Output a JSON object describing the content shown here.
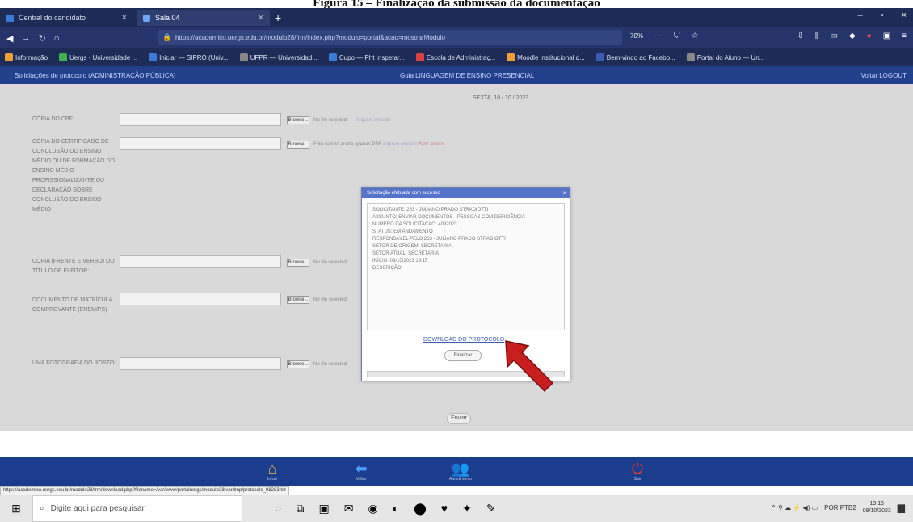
{
  "caption": "Figura 15 – Finalização da submissão da documentação",
  "browser": {
    "tabs": [
      {
        "label": "Central do candidato",
        "close": "×"
      },
      {
        "label": "Sala 04",
        "close": "×"
      }
    ],
    "new_tab": "+",
    "window_controls": [
      "–",
      "▫",
      "×"
    ],
    "url": "https://academico.uergs.edu.br/modulo28/frm/index.php?modulo=portal&acao=mostrarModulo",
    "zoom": "70%",
    "bookmarks": [
      {
        "label": "Informação",
        "color": "#f0a030"
      },
      {
        "label": "Uergs - Universidade ...",
        "color": "#3bb24a"
      },
      {
        "label": "Iniciar — SIPRO (Univ...",
        "color": "#3b7bd8"
      },
      {
        "label": "UFPR — Universidad...",
        "color": "#888888"
      },
      {
        "label": "Cupo — Pht Inspetar...",
        "color": "#3b7bd8"
      },
      {
        "label": "Escola de Administraç...",
        "color": "#e04040"
      },
      {
        "label": "Moodle institucional d...",
        "color": "#f0a030"
      },
      {
        "label": "Bem-vindo ao Facebo...",
        "color": "#3b5bb0"
      },
      {
        "label": "Portal do Aluno — Un...",
        "color": "#888888"
      }
    ]
  },
  "app": {
    "header_left": "Solicitações de protocolo (ADMINISTRAÇÃO PÚBLICA)",
    "header_center": "Guia LINGUAGEM DE ENSINO PRESENCIAL",
    "header_right": "Voltar LOGOUT",
    "date": "SEXTA, 10 / 10 / 2023",
    "rows": [
      {
        "label": "CÓPIA DO CPF:",
        "browse": "Browse...",
        "info": "No file selected.",
        "link": "Arquivo enviado",
        "red": ""
      },
      {
        "label": "CÓPIA DO CERTIFICADO DE CONCLUSÃO DO ENSINO MÉDIO OU DE FORMAÇÃO DO ENSINO MÉDIO PROFISSIONALIZANTE OU DECLARAÇÃO SOBRE CONCLUSÃO DO ENSINO MÉDIO",
        "browse": "Browse...",
        "info": "Este campo aceita apenas PDF",
        "link": "Arquivo enviado",
        "red": "Sem anexo"
      },
      {
        "label": "CÓPIA (FRENTE E VERSO) DO TÍTULO DE ELEITOR:",
        "browse": "Browse...",
        "info": "No file selected.",
        "link": "",
        "red": ""
      },
      {
        "label": "DOCUMENTO DE MATRÍCULA COMPROVANTE (ENEM/PS)",
        "browse": "Browse...",
        "info": "No file selected.",
        "link": "",
        "red": ""
      },
      {
        "label": "UMA FOTOGRAFIA DO ROSTO:",
        "browse": "Browse...",
        "info": "No file selected.",
        "link": "",
        "red": ""
      }
    ],
    "send_label": "Enviar",
    "footer_buttons": [
      {
        "icon": "⌂",
        "label": "Início",
        "color": "#e8c040"
      },
      {
        "icon": "⬅",
        "label": "Voltar",
        "color": "#4aa0ff"
      },
      {
        "icon": "👥",
        "label": "Atendimento",
        "color": "#e8c040"
      },
      {
        "icon": "⏻",
        "label": "Sair",
        "color": "#e33b2b"
      }
    ]
  },
  "modal": {
    "title": "Solicitação efetuada com sucesso",
    "close": "×",
    "text": "SOLICITANTE: 263 - JULIANO PRADO STRADIOTTI\nASSUNTO: ENVIAR DOCUMENTOS - PESSOAS COM DEFICIÊNCIA\nNÚMERO DA SOLICITAÇÃO: 4092023\nSTATUS: EM ANDAMENTO\nRESPONSÁVEL PELO 263 - JULIANO PRADO STRADIOTTI\nSETOR DE ORIGEM: SECRETARIA\nSETOR ATUAL: SECRETARIA\nINÍCIO: 09/10/2023 19:15\nDESCRIÇÃO:",
    "download_link": "DOWNLOAD DO PROTOCOLO",
    "finish_label": "Finalizar"
  },
  "status_url": "https://academico.uergs.edu.br/modulo28/frm/download.php?filename=/var/www/portaluergs/modulo28/var/tmp/protocolo_98283.txt",
  "taskbar": {
    "start": "⊞",
    "search_icon": "⌕",
    "search_placeholder": "Digite aqui para pesquisar",
    "apps": [
      "○",
      "⧉",
      "▣",
      "✉",
      "◉",
      "◐",
      "⬤",
      "♥",
      "✦",
      "✎"
    ],
    "tray_lang": "POR PTB2",
    "time": "19:15",
    "date": "09/10/2023"
  },
  "colors": {
    "tab_bg": "#1e2b57",
    "app_header": "#213f8a",
    "footer": "#1c3c8d",
    "arrow": "#c81e1e"
  }
}
